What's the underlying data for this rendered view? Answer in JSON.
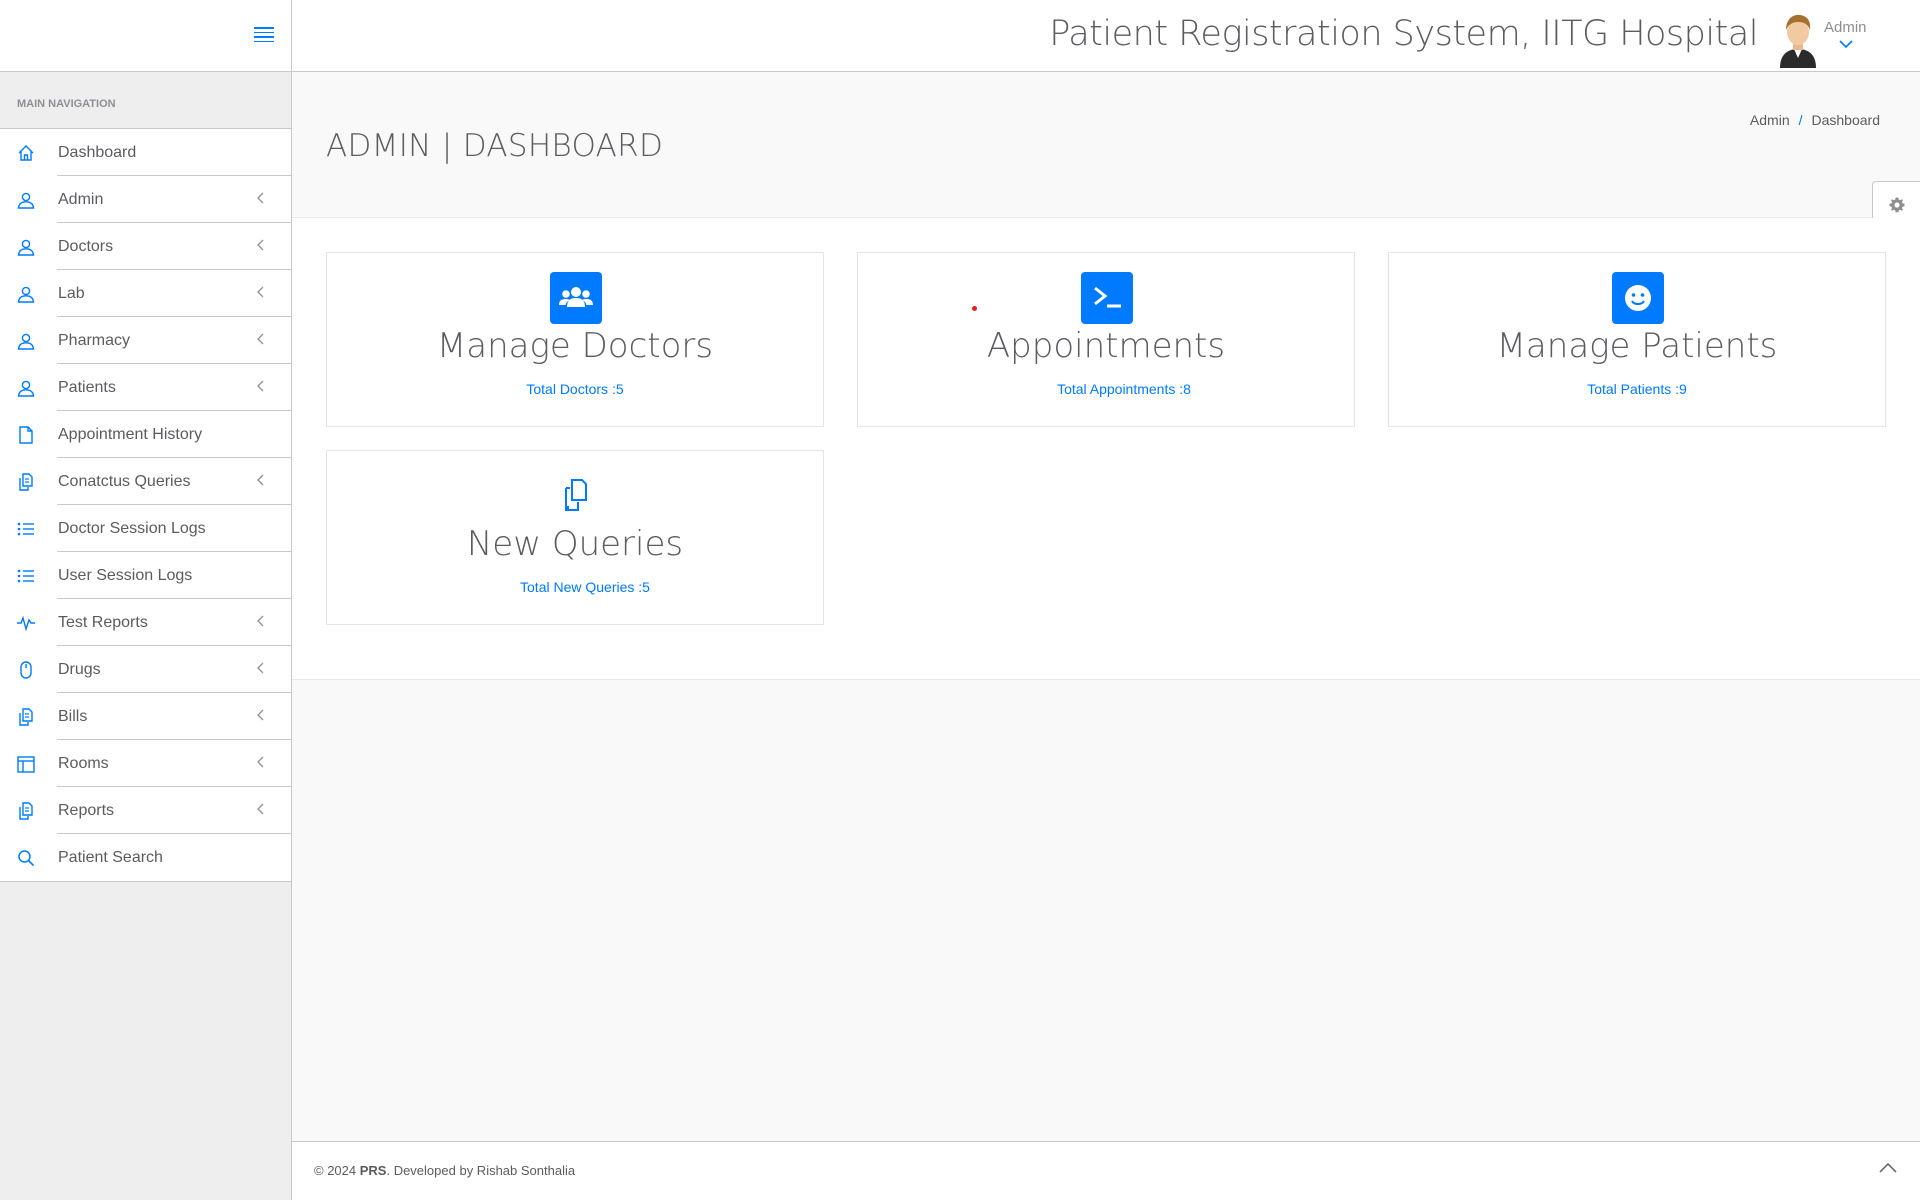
{
  "header": {
    "app_title": "Patient Registration System, IITG Hospital",
    "user_name": "Admin"
  },
  "sidebar": {
    "nav_title": "MAIN NAVIGATION",
    "items": [
      {
        "label": "Dashboard",
        "icon": "home-icon",
        "has_chevron": false
      },
      {
        "label": "Admin",
        "icon": "user-icon",
        "has_chevron": true
      },
      {
        "label": "Doctors",
        "icon": "user-icon",
        "has_chevron": true
      },
      {
        "label": "Lab",
        "icon": "user-icon",
        "has_chevron": true
      },
      {
        "label": "Pharmacy",
        "icon": "user-icon",
        "has_chevron": true
      },
      {
        "label": "Patients",
        "icon": "user-icon",
        "has_chevron": true
      },
      {
        "label": "Appointment History",
        "icon": "file-icon",
        "has_chevron": false
      },
      {
        "label": "Conatctus Queries",
        "icon": "files-icon",
        "has_chevron": true
      },
      {
        "label": "Doctor Session Logs",
        "icon": "list-icon",
        "has_chevron": false
      },
      {
        "label": "User Session Logs",
        "icon": "list-icon",
        "has_chevron": false
      },
      {
        "label": "Test Reports",
        "icon": "pulse-icon",
        "has_chevron": true
      },
      {
        "label": "Drugs",
        "icon": "mouse-icon",
        "has_chevron": true
      },
      {
        "label": "Bills",
        "icon": "files-icon",
        "has_chevron": true
      },
      {
        "label": "Rooms",
        "icon": "layout-icon",
        "has_chevron": true
      },
      {
        "label": "Reports",
        "icon": "files-icon",
        "has_chevron": true
      },
      {
        "label": "Patient Search",
        "icon": "search-icon",
        "has_chevron": false
      }
    ]
  },
  "page": {
    "title": "ADMIN | DASHBOARD",
    "breadcrumb": [
      "Admin",
      "Dashboard"
    ]
  },
  "cards": [
    {
      "title": "Manage Doctors",
      "link": "Total Doctors :5",
      "icon": "users-icon"
    },
    {
      "title": "Appointments",
      "link": "Total Appointments :8",
      "icon": "terminal-icon"
    },
    {
      "title": "Manage Patients",
      "link": "Total Patients :9",
      "icon": "smile-icon"
    },
    {
      "title": "New Queries",
      "link": "Total New Queries :5",
      "icon": "files-icon"
    }
  ],
  "footer": {
    "copyright": "© 2024 ",
    "brand": "PRS",
    "credit": ". Developed by Rishab Sonthalia"
  },
  "colors": {
    "accent": "#007aff",
    "text": "#5b5b60",
    "sidebar_bg": "#eeeeee"
  }
}
